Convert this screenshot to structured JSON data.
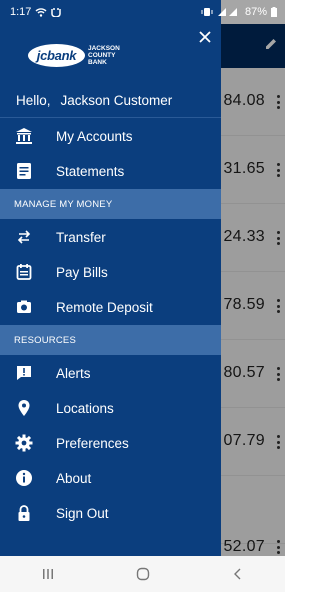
{
  "status_bar": {
    "time": "1:17",
    "battery": "87%",
    "icons": [
      "wifi-icon",
      "carrier-icon",
      "vibrate-icon",
      "signal-icon",
      "battery-icon"
    ]
  },
  "background_list": {
    "amounts": [
      "84.08",
      "31.65",
      "24.33",
      "78.59",
      "80.57",
      "07.79",
      "52.07"
    ]
  },
  "drawer": {
    "logo": {
      "brand": "jcbank",
      "line1": "JACKSON",
      "line2": "COUNTY",
      "line3": "BANK"
    },
    "greeting": {
      "hello": "Hello,",
      "name": "Jackson Customer"
    },
    "items_top": [
      {
        "label": "My Accounts",
        "icon": "bank-icon"
      },
      {
        "label": "Statements",
        "icon": "statements-icon"
      }
    ],
    "section_manage": "MANAGE MY MONEY",
    "items_manage": [
      {
        "label": "Transfer",
        "icon": "transfer-icon"
      },
      {
        "label": "Pay Bills",
        "icon": "pay-bills-icon"
      },
      {
        "label": "Remote Deposit",
        "icon": "camera-icon"
      }
    ],
    "section_resources": "RESOURCES",
    "items_resources": [
      {
        "label": "Alerts",
        "icon": "alert-icon"
      },
      {
        "label": "Locations",
        "icon": "location-pin-icon"
      },
      {
        "label": "Preferences",
        "icon": "gear-icon"
      },
      {
        "label": "About",
        "icon": "info-icon"
      },
      {
        "label": "Sign Out",
        "icon": "lock-icon"
      }
    ]
  },
  "colors": {
    "drawer_bg": "#0b3e7e",
    "section_bg": "#3d6da8",
    "header_bg": "#002a5c"
  }
}
